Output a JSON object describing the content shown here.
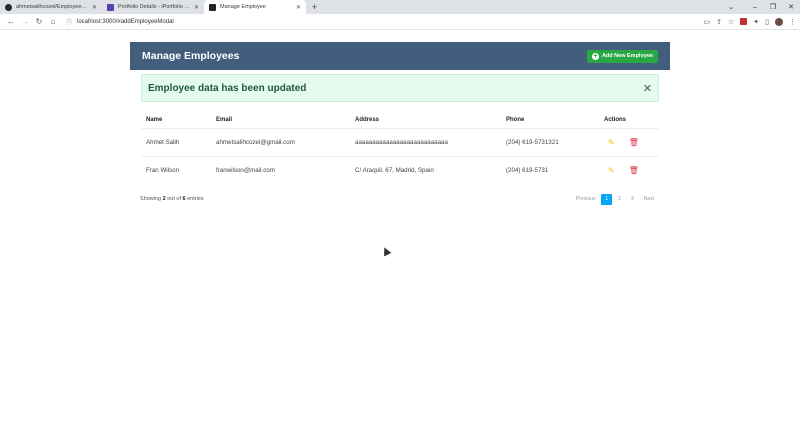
{
  "browser": {
    "tabs": [
      {
        "title": "ahmetsalihcozel/EmployeeMana...",
        "favicon_color": "#24292e",
        "active": false
      },
      {
        "title": "Portfolio Details - iPortfolio Boo...",
        "favicon_color": "#5a3fb3",
        "active": false
      },
      {
        "title": "Manage Employee",
        "favicon_color": "#20232a",
        "active": true
      }
    ],
    "new_tab": "+",
    "url": "localhost:3000/#addEmployeeModal"
  },
  "page": {
    "title": "Manage Employees",
    "add_button": "Add New Employee",
    "alert": "Employee data has been updated",
    "columns": [
      "Name",
      "Email",
      "Address",
      "Phone",
      "Actions"
    ],
    "rows": [
      {
        "name": "Ahmet Salih",
        "email": "ahmetsalihcozel@gmail.com",
        "address": "aaaaaaaaaaaaaaaaaaaaaaaaaaa",
        "phone": "(204) 619-5731321"
      },
      {
        "name": "Fran Wilson",
        "email": "franwilson@mail.com",
        "address": "C/ Araquil, 67, Madrid, Spain",
        "phone": "(204) 619-5731"
      }
    ],
    "showing": {
      "prefix": "Showing",
      "count": "2",
      "middle": "out of",
      "total": "6",
      "suffix": "entries"
    },
    "pagination": {
      "previous": "Previous",
      "pages": [
        "1",
        "2",
        "3"
      ],
      "current": "1",
      "next": "Next"
    }
  },
  "colors": {
    "header": "#435d7d",
    "add_button": "#28a745",
    "alert_bg": "#e5fbef",
    "edit": "#ffc107",
    "delete": "#dc3545",
    "page_active": "#03a9f4"
  }
}
